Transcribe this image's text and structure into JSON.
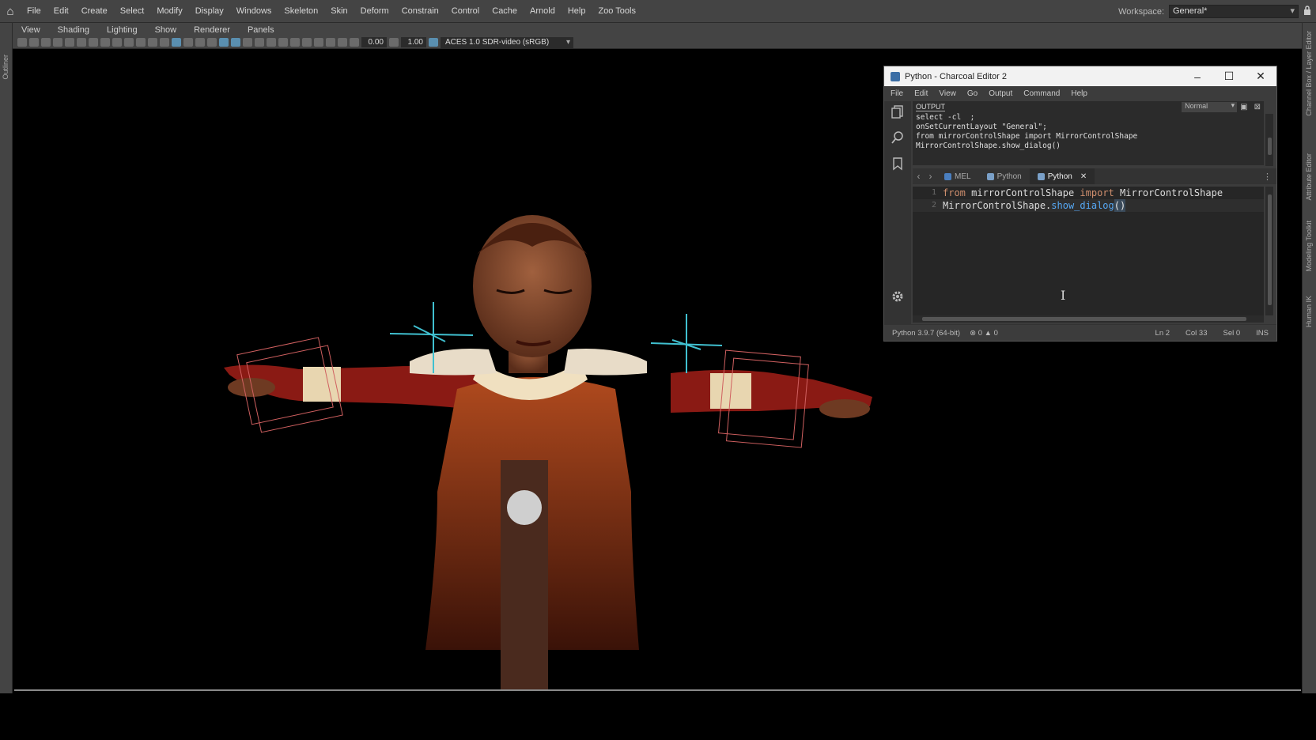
{
  "menubar": {
    "items": [
      "File",
      "Edit",
      "Create",
      "Select",
      "Modify",
      "Display",
      "Windows",
      "Skeleton",
      "Skin",
      "Deform",
      "Constrain",
      "Control",
      "Cache",
      "Arnold",
      "Help",
      "Zoo Tools"
    ],
    "workspace_label": "Workspace:",
    "workspace_value": "General*"
  },
  "left_strip": {
    "label": "Outliner"
  },
  "right_strip": {
    "tabs": [
      "Channel Box / Layer Editor",
      "Attribute Editor",
      "Modeling Toolkit",
      "Human IK"
    ]
  },
  "panel_menu": {
    "items": [
      "View",
      "Shading",
      "Lighting",
      "Show",
      "Renderer",
      "Panels"
    ]
  },
  "panel_toolbar": {
    "exposure": "0.00",
    "gamma": "1.00",
    "color_space": "ACES 1.0 SDR-video (sRGB)"
  },
  "editor": {
    "title": "Python - Charcoal Editor 2",
    "menu": [
      "File",
      "Edit",
      "View",
      "Go",
      "Output",
      "Command",
      "Help"
    ],
    "output_title": "OUTPUT",
    "output_filter": "Normal",
    "output_lines": [
      "select -cl  ;",
      "onSetCurrentLayout \"General\";",
      "from mirrorControlShape import MirrorControlShape",
      "MirrorControlShape.show_dialog()"
    ],
    "tabs": [
      {
        "label": "MEL",
        "color": "#4a7fc0",
        "active": false
      },
      {
        "label": "Python",
        "color": "#7aa0c8",
        "active": false
      },
      {
        "label": "Python",
        "color": "#7aa0c8",
        "active": true
      }
    ],
    "code": {
      "line1_no": "1",
      "line1_from": "from",
      "line1_module": "mirrorControlShape",
      "line1_import": "import",
      "line1_class": "MirrorControlShape",
      "line2_no": "2",
      "line2_obj": "MirrorControlShape.",
      "line2_fn": "show_dialog",
      "line2_paren": "()"
    },
    "status": {
      "python": "Python 3.9.7 (64-bit)",
      "errors": "0",
      "warnings": "0",
      "ln": "Ln 2",
      "col": "Col 33",
      "sel": "Sel 0",
      "mode": "INS"
    }
  }
}
